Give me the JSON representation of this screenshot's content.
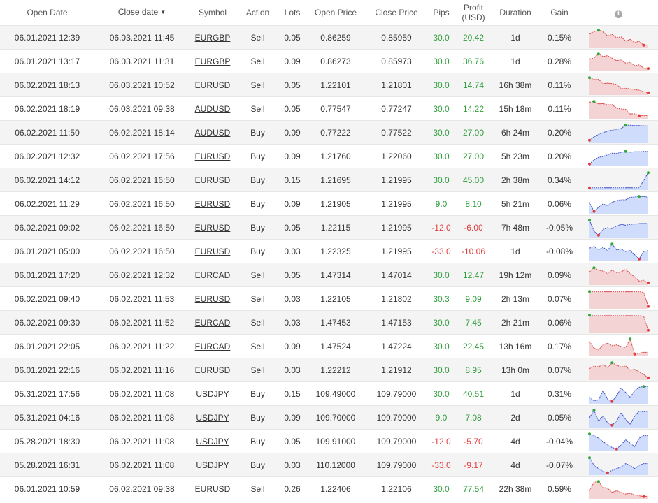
{
  "header": {
    "open_date": "Open Date",
    "close_date": "Close date",
    "sort_arrow": "▼",
    "symbol": "Symbol",
    "action": "Action",
    "lots": "Lots",
    "open_price": "Open Price",
    "close_price": "Close Price",
    "pips": "Pips",
    "profit_line1": "Profit",
    "profit_line2": "(USD)",
    "duration": "Duration",
    "gain": "Gain",
    "info_icon": "info-icon"
  },
  "colors": {
    "positive": "#2e9d3a",
    "negative": "#e23c3c",
    "sell_fill": "#f3d3d3",
    "sell_line": "#e04848",
    "buy_fill": "#cfdcfb",
    "buy_line": "#3c50c8",
    "max_dot": "#2eaa3a",
    "min_dot": "#e23c3c"
  },
  "trades": [
    {
      "open_date": "06.01.2021 12:39",
      "close_date": "06.03.2021 11:45",
      "symbol": "EURGBP",
      "action": "Sell",
      "lots": "0.05",
      "open_price": "0.86259",
      "close_price": "0.85959",
      "pips": "30.0",
      "profit": "20.42",
      "duration": "1d",
      "gain": "0.15%",
      "spark": [
        0.75,
        0.85,
        0.95,
        0.88,
        0.6,
        0.7,
        0.5,
        0.55,
        0.3,
        0.4,
        0.2,
        0.3,
        0.05,
        0.08
      ]
    },
    {
      "open_date": "06.01.2021 13:17",
      "close_date": "06.03.2021 11:31",
      "symbol": "EURGBP",
      "action": "Sell",
      "lots": "0.09",
      "open_price": "0.86273",
      "close_price": "0.85973",
      "pips": "30.0",
      "profit": "36.76",
      "duration": "1d",
      "gain": "0.28%",
      "spark": [
        0.65,
        0.7,
        0.95,
        0.8,
        0.85,
        0.7,
        0.55,
        0.6,
        0.4,
        0.45,
        0.25,
        0.3,
        0.1,
        0.08
      ]
    },
    {
      "open_date": "06.02.2021 18:13",
      "close_date": "06.03.2021 10:52",
      "symbol": "EURUSD",
      "action": "Sell",
      "lots": "0.05",
      "open_price": "1.22101",
      "close_price": "1.21801",
      "pips": "30.0",
      "profit": "14.74",
      "duration": "16h 38m",
      "gain": "0.11%",
      "spark": [
        0.95,
        0.85,
        0.85,
        0.6,
        0.62,
        0.6,
        0.55,
        0.3,
        0.32,
        0.28,
        0.25,
        0.2,
        0.12,
        0.05
      ]
    },
    {
      "open_date": "06.02.2021 18:19",
      "close_date": "06.03.2021 09:38",
      "symbol": "AUDUSD",
      "action": "Sell",
      "lots": "0.05",
      "open_price": "0.77547",
      "close_price": "0.77247",
      "pips": "30.0",
      "profit": "14.22",
      "duration": "15h 18m",
      "gain": "0.11%",
      "spark": [
        0.9,
        0.95,
        0.8,
        0.82,
        0.75,
        0.76,
        0.55,
        0.5,
        0.48,
        0.2,
        0.22,
        0.1,
        0.12,
        0.1
      ]
    },
    {
      "open_date": "06.02.2021 11:50",
      "close_date": "06.02.2021 18:14",
      "symbol": "AUDUSD",
      "action": "Buy",
      "lots": "0.09",
      "open_price": "0.77222",
      "close_price": "0.77522",
      "pips": "30.0",
      "profit": "27.00",
      "duration": "6h 24m",
      "gain": "0.20%",
      "spark": [
        0.05,
        0.25,
        0.4,
        0.5,
        0.6,
        0.65,
        0.7,
        0.75,
        0.95,
        0.95,
        0.92,
        0.93,
        0.92,
        0.9
      ]
    },
    {
      "open_date": "06.02.2021 12:32",
      "close_date": "06.02.2021 17:56",
      "symbol": "EURUSD",
      "action": "Buy",
      "lots": "0.09",
      "open_price": "1.21760",
      "close_price": "1.22060",
      "pips": "30.0",
      "profit": "27.00",
      "duration": "5h 23m",
      "gain": "0.20%",
      "spark": [
        0.05,
        0.3,
        0.45,
        0.5,
        0.6,
        0.7,
        0.68,
        0.75,
        0.8,
        0.75,
        0.78,
        0.78,
        0.8,
        0.8
      ]
    },
    {
      "open_date": "06.02.2021 14:12",
      "close_date": "06.02.2021 16:50",
      "symbol": "EURUSD",
      "action": "Buy",
      "lots": "0.15",
      "open_price": "1.21695",
      "close_price": "1.21995",
      "pips": "30.0",
      "profit": "45.00",
      "duration": "2h 38m",
      "gain": "0.34%",
      "spark": [
        0.05,
        0.05,
        0.05,
        0.05,
        0.05,
        0.05,
        0.05,
        0.05,
        0.05,
        0.05,
        0.05,
        0.05,
        0.5,
        0.95
      ]
    },
    {
      "open_date": "06.02.2021 11:29",
      "close_date": "06.02.2021 16:50",
      "symbol": "EURUSD",
      "action": "Buy",
      "lots": "0.09",
      "open_price": "1.21905",
      "close_price": "1.21995",
      "pips": "9.0",
      "profit": "8.10",
      "duration": "5h 21m",
      "gain": "0.06%",
      "spark": [
        0.6,
        0.05,
        0.3,
        0.5,
        0.4,
        0.6,
        0.7,
        0.75,
        0.75,
        0.9,
        0.92,
        0.95,
        0.95,
        0.9
      ]
    },
    {
      "open_date": "06.02.2021 09:02",
      "close_date": "06.02.2021 16:50",
      "symbol": "EURUSD",
      "action": "Buy",
      "lots": "0.05",
      "open_price": "1.22115",
      "close_price": "1.21995",
      "pips": "-12.0",
      "profit": "-6.00",
      "duration": "7h 48m",
      "gain": "-0.05%",
      "spark": [
        0.95,
        0.3,
        0.05,
        0.4,
        0.5,
        0.45,
        0.6,
        0.7,
        0.65,
        0.7,
        0.72,
        0.75,
        0.75,
        0.75
      ]
    },
    {
      "open_date": "06.01.2021 05:00",
      "close_date": "06.02.2021 16:50",
      "symbol": "EURUSD",
      "action": "Buy",
      "lots": "0.03",
      "open_price": "1.22325",
      "close_price": "1.21995",
      "pips": "-33.0",
      "profit": "-10.06",
      "duration": "1d",
      "gain": "-0.08%",
      "spark": [
        0.7,
        0.8,
        0.6,
        0.75,
        0.55,
        0.95,
        0.6,
        0.65,
        0.5,
        0.55,
        0.3,
        0.05,
        0.5,
        0.55
      ]
    },
    {
      "open_date": "06.01.2021 17:20",
      "close_date": "06.02.2021 12:32",
      "symbol": "EURCAD",
      "action": "Sell",
      "lots": "0.05",
      "open_price": "1.47314",
      "close_price": "1.47014",
      "pips": "30.0",
      "profit": "12.47",
      "duration": "19h 12m",
      "gain": "0.09%",
      "spark": [
        0.7,
        0.95,
        0.8,
        0.75,
        0.6,
        0.8,
        0.65,
        0.7,
        0.85,
        0.6,
        0.4,
        0.15,
        0.2,
        0.05
      ]
    },
    {
      "open_date": "06.02.2021 09:40",
      "close_date": "06.02.2021 11:53",
      "symbol": "EURUSD",
      "action": "Sell",
      "lots": "0.03",
      "open_price": "1.22105",
      "close_price": "1.21802",
      "pips": "30.3",
      "profit": "9.09",
      "duration": "2h 13m",
      "gain": "0.07%",
      "spark": [
        0.95,
        0.93,
        0.93,
        0.93,
        0.93,
        0.93,
        0.93,
        0.93,
        0.93,
        0.93,
        0.93,
        0.93,
        0.9,
        0.05
      ]
    },
    {
      "open_date": "06.02.2021 09:30",
      "close_date": "06.02.2021 11:52",
      "symbol": "EURCAD",
      "action": "Sell",
      "lots": "0.03",
      "open_price": "1.47453",
      "close_price": "1.47153",
      "pips": "30.0",
      "profit": "7.45",
      "duration": "2h 21m",
      "gain": "0.06%",
      "spark": [
        0.95,
        0.92,
        0.92,
        0.92,
        0.92,
        0.92,
        0.92,
        0.92,
        0.92,
        0.92,
        0.92,
        0.92,
        0.88,
        0.05
      ]
    },
    {
      "open_date": "06.01.2021 22:05",
      "close_date": "06.02.2021 11:22",
      "symbol": "EURCAD",
      "action": "Sell",
      "lots": "0.09",
      "open_price": "1.47524",
      "close_price": "1.47224",
      "pips": "30.0",
      "profit": "22.45",
      "duration": "13h 16m",
      "gain": "0.17%",
      "spark": [
        0.8,
        0.4,
        0.3,
        0.6,
        0.7,
        0.55,
        0.6,
        0.5,
        0.45,
        0.95,
        0.05,
        0.1,
        0.15,
        0.15
      ]
    },
    {
      "open_date": "06.01.2021 22:16",
      "close_date": "06.02.2021 11:16",
      "symbol": "EURUSD",
      "action": "Sell",
      "lots": "0.03",
      "open_price": "1.22212",
      "close_price": "1.21912",
      "pips": "30.0",
      "profit": "8.95",
      "duration": "13h 0m",
      "gain": "0.07%",
      "spark": [
        0.6,
        0.75,
        0.7,
        0.85,
        0.65,
        0.95,
        0.8,
        0.7,
        0.75,
        0.5,
        0.55,
        0.4,
        0.25,
        0.05
      ]
    },
    {
      "open_date": "05.31.2021 17:56",
      "close_date": "06.02.2021 11:08",
      "symbol": "USDJPY",
      "action": "Buy",
      "lots": "0.15",
      "open_price": "109.49000",
      "close_price": "109.79000",
      "pips": "30.0",
      "profit": "40.51",
      "duration": "1d",
      "gain": "0.31%",
      "spark": [
        0.3,
        0.1,
        0.15,
        0.7,
        0.2,
        0.05,
        0.4,
        0.85,
        0.6,
        0.3,
        0.7,
        0.9,
        0.95,
        0.95
      ]
    },
    {
      "open_date": "05.31.2021 04:16",
      "close_date": "06.02.2021 11:08",
      "symbol": "USDJPY",
      "action": "Buy",
      "lots": "0.09",
      "open_price": "109.70000",
      "close_price": "109.79000",
      "pips": "9.0",
      "profit": "7.08",
      "duration": "2d",
      "gain": "0.05%",
      "spark": [
        0.5,
        0.95,
        0.3,
        0.6,
        0.2,
        0.05,
        0.3,
        0.8,
        0.4,
        0.1,
        0.6,
        0.9,
        0.85,
        0.9
      ]
    },
    {
      "open_date": "05.28.2021 18:30",
      "close_date": "06.02.2021 11:08",
      "symbol": "USDJPY",
      "action": "Buy",
      "lots": "0.05",
      "open_price": "109.91000",
      "close_price": "109.79000",
      "pips": "-12.0",
      "profit": "-5.70",
      "duration": "4d",
      "gain": "-0.04%",
      "spark": [
        0.95,
        0.85,
        0.7,
        0.5,
        0.3,
        0.15,
        0.05,
        0.3,
        0.6,
        0.4,
        0.2,
        0.7,
        0.85,
        0.85
      ]
    },
    {
      "open_date": "05.28.2021 16:31",
      "close_date": "06.02.2021 11:08",
      "symbol": "USDJPY",
      "action": "Buy",
      "lots": "0.03",
      "open_price": "110.12000",
      "close_price": "109.79000",
      "pips": "-33.0",
      "profit": "-9.17",
      "duration": "4d",
      "gain": "-0.07%",
      "spark": [
        0.95,
        0.5,
        0.3,
        0.15,
        0.05,
        0.2,
        0.3,
        0.4,
        0.6,
        0.5,
        0.3,
        0.5,
        0.6,
        0.6
      ]
    },
    {
      "open_date": "06.01.2021 10:59",
      "close_date": "06.02.2021 09:38",
      "symbol": "EURUSD",
      "action": "Sell",
      "lots": "0.26",
      "open_price": "1.22406",
      "close_price": "1.22106",
      "pips": "30.0",
      "profit": "77.54",
      "duration": "22h 38m",
      "gain": "0.59%",
      "spark": [
        0.4,
        0.9,
        0.95,
        0.6,
        0.55,
        0.3,
        0.4,
        0.3,
        0.2,
        0.25,
        0.15,
        0.1,
        0.05,
        0.08
      ]
    }
  ]
}
